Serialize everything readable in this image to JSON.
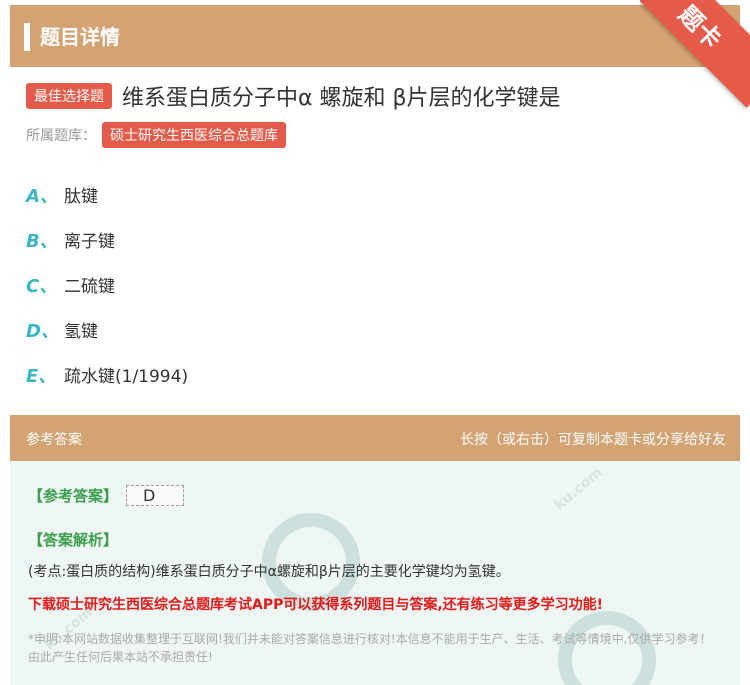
{
  "header": {
    "title": "题目详情",
    "ribbon": "题卡"
  },
  "question": {
    "type_badge": "最佳选择题",
    "text": "维系蛋白质分子中α 螺旋和 β片层的化学键是",
    "bank_label": "所属题库：",
    "bank_name": "硕士研究生西医综合总题库"
  },
  "options": [
    {
      "letter": "A、",
      "text": "肽键"
    },
    {
      "letter": "B、",
      "text": "离子键"
    },
    {
      "letter": "C、",
      "text": "二硫键"
    },
    {
      "letter": "D、",
      "text": "氢键"
    },
    {
      "letter": "E、",
      "text": "疏水键(1/1994)"
    }
  ],
  "answer_section": {
    "title": "参考答案",
    "hint": "长按（或右击）可复制本题卡或分享给好友",
    "answer_tag": "【参考答案】",
    "answer_value": "D",
    "explanation_tag": "【答案解析】",
    "explanation": "(考点:蛋白质的结构)维系蛋白质分子中α螺旋和β片层的主要化学键均为氢键。",
    "promo": "下载硕士研究生西医综合总题库考试APP可以获得系列题目与答案,还有练习等更多学习功能!",
    "disclaimer": "*申明:本网站数据收集整理于互联网!我们并未能对答案信息进行核对!本信息不能用于生产、生活、考试等情境中,仅供学习参考！由此产生任何后果本站不承担责任!"
  }
}
